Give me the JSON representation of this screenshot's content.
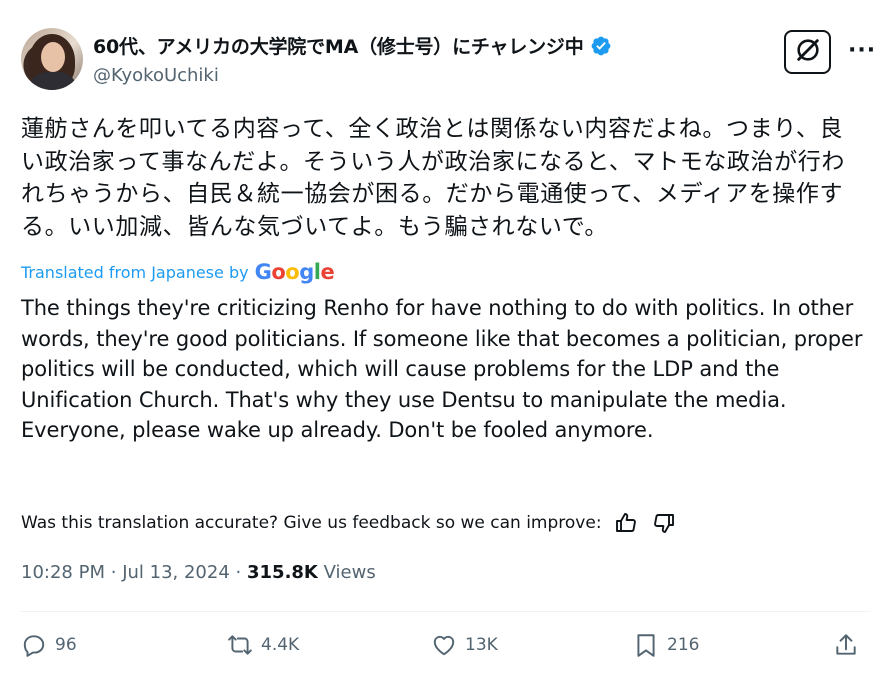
{
  "author": {
    "display_name": "60代、アメリカの大学院でMA（修士号）にチャレンジ中",
    "handle": "@KyokoUchiki"
  },
  "tweet": {
    "original_text": "蓮舫さんを叩いてる内容って、全く政治とは関係ない内容だよね。つまり、良い政治家って事なんだよ。そういう人が政治家になると、マトモな政治が行われちゃうから、自民＆統一協会が困る。だから電通使って、メディアを操作する。いい加減、皆んな気づいてよ。もう騙されないで。",
    "translated_from_label": "Translated from Japanese by",
    "translation_provider": "Google",
    "translation_text": "The things they're criticizing Renho for have nothing to do with politics. In other words, they're good politicians. If someone like that becomes a politician, proper politics will be conducted, which will cause problems for the LDP and the Unification Church. That's why they use Dentsu to manipulate the media. Everyone, please wake up already. Don't be fooled anymore.",
    "feedback_prompt": "Was this translation accurate? Give us feedback so we can improve:",
    "time": "10:28 PM",
    "separator": "·",
    "date": "Jul 13, 2024",
    "views_count": "315.8K",
    "views_label": "Views"
  },
  "actions": {
    "replies": "96",
    "reposts": "4.4K",
    "likes": "13K",
    "bookmarks": "216"
  },
  "colors": {
    "accent": "#1d9bf0",
    "text": "#0f1419",
    "muted": "#536471"
  },
  "icons": {
    "verified": "verified-badge-icon",
    "grok": "grok-icon",
    "more": "more-icon",
    "thumbs_up": "thumbs-up-icon",
    "thumbs_down": "thumbs-down-icon",
    "reply": "reply-icon",
    "repost": "repost-icon",
    "like": "heart-icon",
    "bookmark": "bookmark-icon",
    "share": "share-icon"
  }
}
